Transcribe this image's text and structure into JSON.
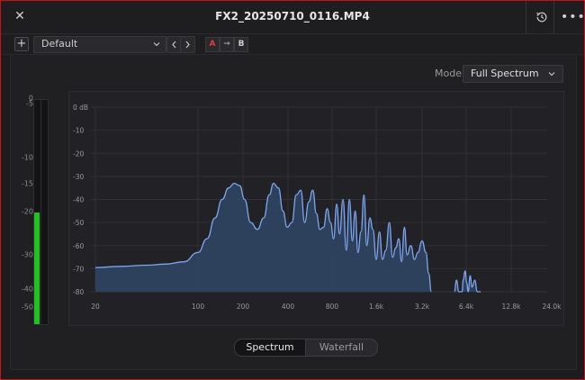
{
  "window": {
    "title": "FX2_20250710_0116.MP4",
    "close_glyph": "✕",
    "more_glyph": "•••"
  },
  "toolbar": {
    "add_glyph": "+",
    "preset_value": "Default",
    "a_label": "A",
    "b_label": "B",
    "copy_arrow": "→"
  },
  "mode": {
    "label": "Mode",
    "value": "Full Spectrum"
  },
  "meter": {
    "scale_labels": [
      "0",
      "-5",
      "-10",
      "-15",
      "-20",
      "-30",
      "-40",
      "-50"
    ],
    "level_db": -20,
    "color": "#1fc21f"
  },
  "view_tabs": {
    "spectrum": "Spectrum",
    "waterfall": "Waterfall",
    "active": "Spectrum"
  },
  "chart_data": {
    "type": "area",
    "title": "",
    "xlabel": "",
    "ylabel": "",
    "x_scale": "log",
    "x_tick_labels": [
      "20",
      "100",
      "200",
      "400",
      "800",
      "1.6k",
      "3.2k",
      "6.4k",
      "12.8k",
      "24.0k"
    ],
    "x_tick_values": [
      20,
      100,
      200,
      400,
      800,
      1600,
      3200,
      6400,
      12800,
      24000
    ],
    "y_tick_labels": [
      "0 dB",
      "-10",
      "-20",
      "-30",
      "-40",
      "-50",
      "-60",
      "-70",
      "-80"
    ],
    "ylim": [
      -80,
      0
    ],
    "xlim": [
      20,
      24000
    ],
    "grid": true,
    "line_color": "#7ea6f0",
    "fill_color": "#2f4766",
    "series": [
      {
        "x": [
          20,
          30,
          45,
          60,
          80,
          100,
          115,
          130,
          145,
          160,
          175,
          190,
          205,
          225,
          250,
          275,
          300,
          320,
          345,
          370,
          395,
          425,
          455,
          490,
          520,
          555,
          590,
          625,
          660,
          700,
          740,
          780,
          820,
          860,
          900,
          950,
          1000,
          1050,
          1100,
          1150,
          1200,
          1260,
          1320,
          1380,
          1450,
          1520,
          1600,
          1680,
          1760,
          1850,
          1950,
          2050,
          2150,
          2250,
          2350,
          2450,
          2550,
          2700,
          2850,
          3000,
          3200,
          3400,
          3550,
          3700
        ],
        "y": [
          -69.5,
          -69,
          -68.5,
          -68,
          -67,
          -63,
          -57,
          -48,
          -40,
          -35,
          -33,
          -34,
          -40,
          -50,
          -53,
          -48,
          -38,
          -33,
          -35,
          -45,
          -52,
          -50,
          -38,
          -36,
          -50,
          -41,
          -36,
          -46,
          -53,
          -52,
          -44,
          -50,
          -57,
          -42,
          -55,
          -40,
          -62,
          -40,
          -58,
          -45,
          -63,
          -54,
          -38,
          -60,
          -48,
          -53,
          -66,
          -54,
          -66,
          -62,
          -50,
          -65,
          -61,
          -57,
          -67,
          -52,
          -64,
          -60,
          -66,
          -63,
          -58,
          -63,
          -72,
          -80
        ]
      },
      {
        "x": [
          5300,
          5500,
          5700,
          5850,
          6000,
          6100,
          6300,
          6450,
          6600,
          6800,
          7000,
          7300,
          7600,
          8000
        ],
        "y": [
          -80,
          -75,
          -80,
          -80,
          -80,
          -75,
          -71,
          -76,
          -80,
          -73,
          -78,
          -75,
          -80,
          -80
        ]
      }
    ]
  }
}
